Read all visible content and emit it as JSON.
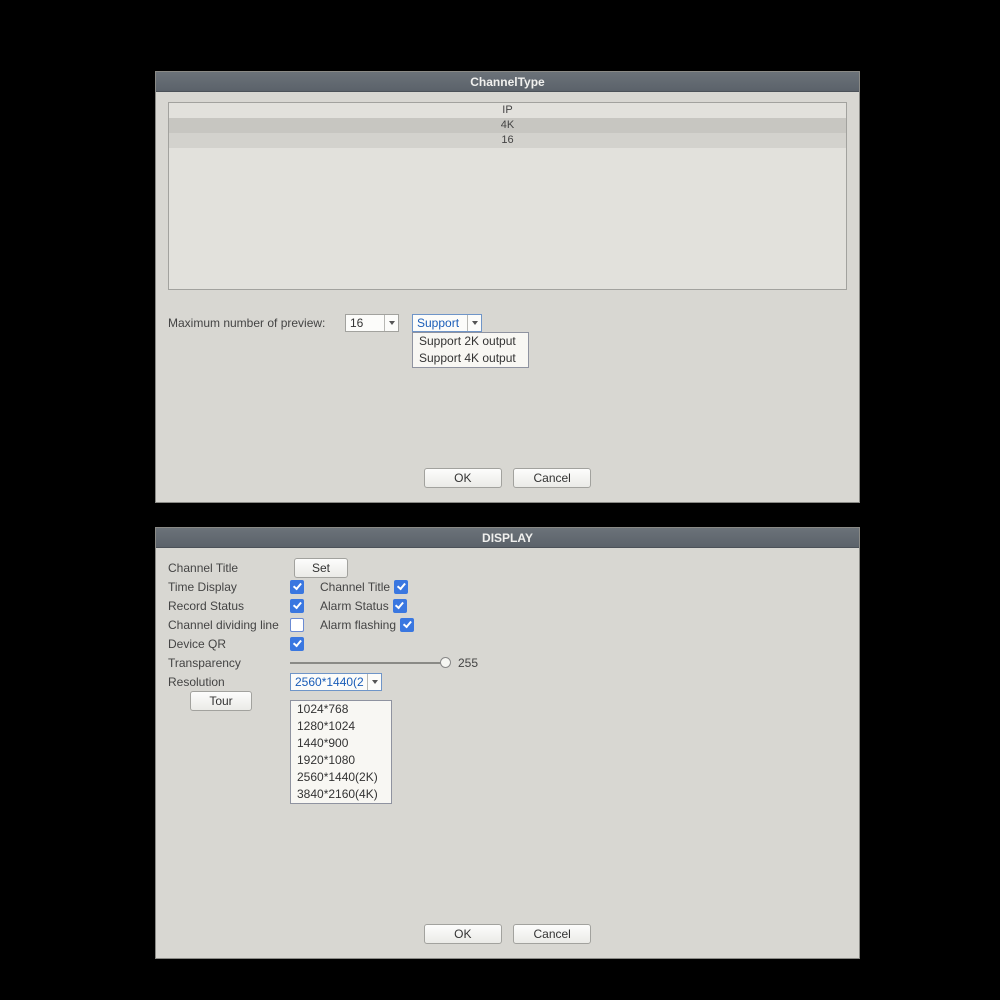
{
  "channeltype": {
    "title": "ChannelType",
    "list": {
      "header": "IP",
      "row_sel": "4K",
      "row_alt": "16"
    },
    "preview": {
      "label": "Maximum number of preview:",
      "value": "16",
      "support_selected": "Support",
      "support_options": [
        "Support 2K output",
        "Support 4K output"
      ]
    },
    "buttons": {
      "ok": "OK",
      "cancel": "Cancel"
    }
  },
  "display": {
    "title": "DISPLAY",
    "channel_title_label": "Channel Title",
    "set_btn": "Set",
    "time_display_label": "Time Display",
    "channel_title2_label": "Channel Title",
    "record_status_label": "Record Status",
    "alarm_status_label": "Alarm Status",
    "channel_div_label": "Channel dividing line",
    "alarm_flashing_label": "Alarm flashing",
    "device_qr_label": "Device QR",
    "transparency_label": "Transparency",
    "transparency_value": "255",
    "resolution_label": "Resolution",
    "resolution_selected": "2560*1440(2",
    "resolution_options": [
      "1024*768",
      "1280*1024",
      "1440*900",
      "1920*1080",
      "2560*1440(2K)",
      "3840*2160(4K)"
    ],
    "tour_btn": "Tour",
    "buttons": {
      "ok": "OK",
      "cancel": "Cancel"
    },
    "checks": {
      "time_display": true,
      "channel_title": true,
      "record_status": true,
      "alarm_status": true,
      "channel_div": false,
      "alarm_flashing": true,
      "device_qr": true
    }
  }
}
